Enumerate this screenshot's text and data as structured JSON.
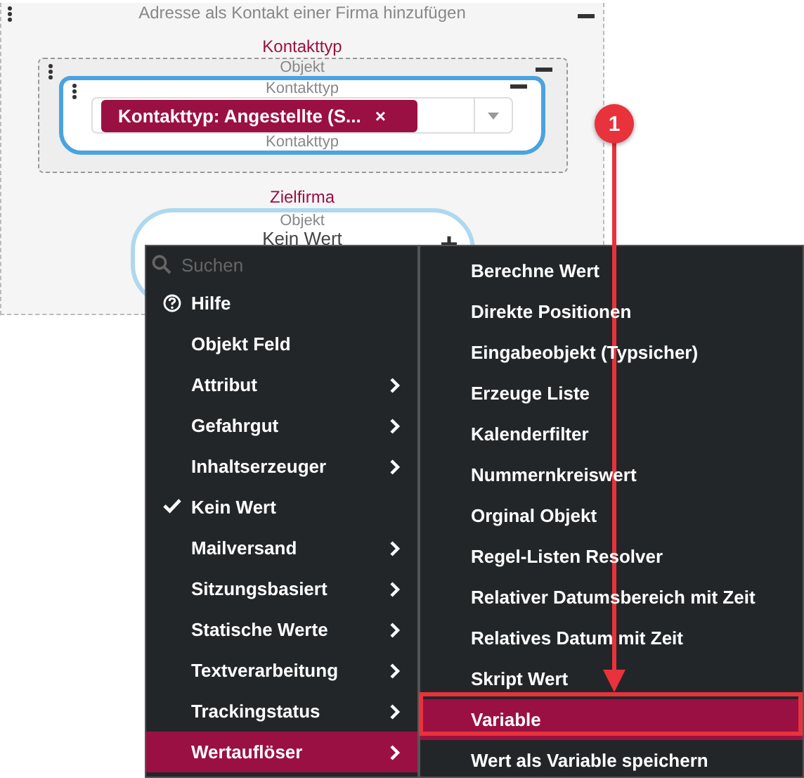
{
  "panel": {
    "title": "Adresse als Kontakt einer Firma hinzufügen",
    "sections": [
      {
        "kind": "group",
        "label": "Kontakttyp",
        "group_label": "Objekt",
        "field_label": "Kontakttyp",
        "chip": "Kontakttyp: Angestellte (S...",
        "chip_close": "×",
        "footer": "Kontakttyp"
      },
      {
        "kind": "node",
        "label": "Zielfirma",
        "node_label": "Objekt",
        "value": "Kein Wert"
      }
    ]
  },
  "menu": {
    "search": {
      "placeholder": "Suchen"
    },
    "items": [
      {
        "label": "Hilfe",
        "kind": "help",
        "checked": false,
        "selected": false
      },
      {
        "label": "Objekt Feld",
        "kind": "leaf",
        "checked": false,
        "selected": false
      },
      {
        "label": "Attribut",
        "kind": "branch",
        "checked": false,
        "selected": false
      },
      {
        "label": "Gefahrgut",
        "kind": "branch",
        "checked": false,
        "selected": false
      },
      {
        "label": "Inhaltserzeuger",
        "kind": "branch",
        "checked": false,
        "selected": false
      },
      {
        "label": "Kein Wert",
        "kind": "leaf",
        "checked": true,
        "selected": false
      },
      {
        "label": "Mailversand",
        "kind": "branch",
        "checked": false,
        "selected": false
      },
      {
        "label": "Sitzungsbasiert",
        "kind": "branch",
        "checked": false,
        "selected": false
      },
      {
        "label": "Statische Werte",
        "kind": "branch",
        "checked": false,
        "selected": false
      },
      {
        "label": "Textverarbeitung",
        "kind": "branch",
        "checked": false,
        "selected": false
      },
      {
        "label": "Trackingstatus",
        "kind": "branch",
        "checked": false,
        "selected": false
      },
      {
        "label": "Wertauflöser",
        "kind": "branch",
        "checked": false,
        "selected": true
      }
    ]
  },
  "submenu": {
    "items": [
      {
        "label": "Berechne Wert",
        "selected": false
      },
      {
        "label": "Direkte Positionen",
        "selected": false
      },
      {
        "label": "Eingabeobjekt (Typsicher)",
        "selected": false
      },
      {
        "label": "Erzeuge Liste",
        "selected": false
      },
      {
        "label": "Kalenderfilter",
        "selected": false
      },
      {
        "label": "Nummernkreiswert",
        "selected": false
      },
      {
        "label": "Orginal Objekt",
        "selected": false
      },
      {
        "label": "Regel-Listen Resolver",
        "selected": false
      },
      {
        "label": "Relativer Datumsbereich mit Zeit",
        "selected": false
      },
      {
        "label": "Relatives Datum mit Zeit",
        "selected": false
      },
      {
        "label": "Skript Wert",
        "selected": false
      },
      {
        "label": "Variable",
        "selected": true
      },
      {
        "label": "Wert als Variable speichern",
        "selected": false
      }
    ]
  },
  "annotation": {
    "badge": "1"
  }
}
